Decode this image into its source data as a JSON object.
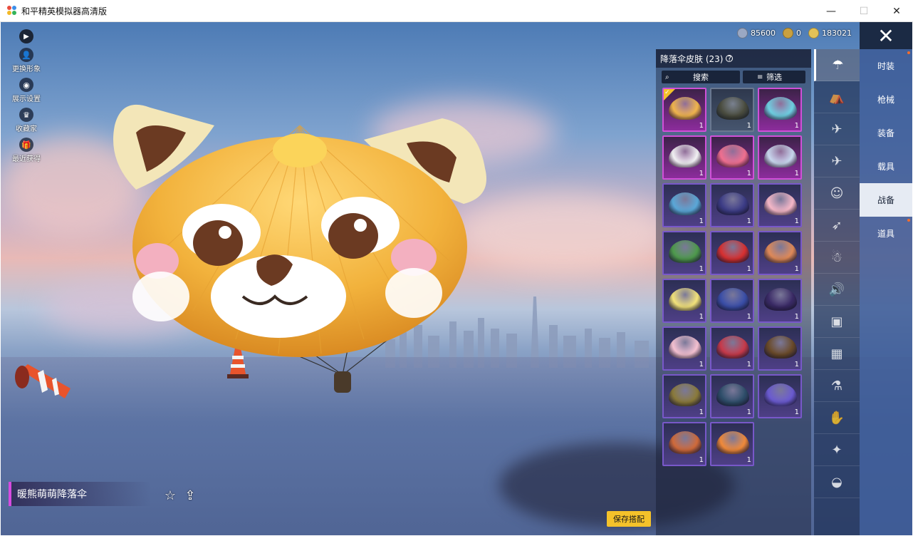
{
  "window": {
    "title": "和平精英模拟器高清版",
    "minimize": "—",
    "maximize": "☐",
    "close": "✕"
  },
  "currency": [
    {
      "icon": "silver-coin-icon",
      "value": "85600",
      "color": "#9aa8c4"
    },
    {
      "icon": "point-coin-icon",
      "value": "0",
      "color": "#c9a040"
    },
    {
      "icon": "gold-coin-icon",
      "value": "183021",
      "color": "#e3c258"
    }
  ],
  "left_icons": [
    {
      "label": "更换形象",
      "glyph": "👤"
    },
    {
      "label": "展示设置",
      "glyph": "◉"
    },
    {
      "label": "收藏家",
      "glyph": "♛"
    },
    {
      "label": "最近获得",
      "glyph": "🎁"
    }
  ],
  "panel": {
    "title": "降落伞皮肤 (23)",
    "search_label": "搜索",
    "filter_label": "筛选"
  },
  "skins": [
    {
      "style": "pink",
      "color": "#f1b64c",
      "count": "1",
      "equipped": true
    },
    {
      "style": "gray",
      "color": "#4a4c3e",
      "count": "1"
    },
    {
      "style": "pink",
      "color": "#6ed0e2",
      "count": "1"
    },
    {
      "style": "pink",
      "color": "#f2f2f4",
      "count": "1"
    },
    {
      "style": "pink",
      "color": "#f07090",
      "count": "1"
    },
    {
      "style": "pink",
      "color": "#c8d8ee",
      "count": "1"
    },
    {
      "style": "blue",
      "color": "#5aa8d8",
      "count": "1"
    },
    {
      "style": "blue",
      "color": "#3c3c86",
      "count": "1"
    },
    {
      "style": "blue",
      "color": "#f6b8c8",
      "count": "1"
    },
    {
      "style": "blue",
      "color": "#4e9a4c",
      "count": "1"
    },
    {
      "style": "blue",
      "color": "#d83030",
      "count": "1"
    },
    {
      "style": "blue",
      "color": "#e08a58",
      "count": "1"
    },
    {
      "style": "blue",
      "color": "#f4e47a",
      "count": "1"
    },
    {
      "style": "blue",
      "color": "#3a4ea8",
      "count": "1"
    },
    {
      "style": "blue",
      "color": "#3a2a66",
      "count": "1"
    },
    {
      "style": "blue",
      "color": "#f6c2d2",
      "count": "1"
    },
    {
      "style": "blue",
      "color": "#c83a4a",
      "count": "1"
    },
    {
      "style": "blue",
      "color": "#6a4a28",
      "count": "1"
    },
    {
      "style": "blue",
      "color": "#8a7a3a",
      "count": "1"
    },
    {
      "style": "blue",
      "color": "#2e4e6a",
      "count": "1"
    },
    {
      "style": "blue",
      "color": "#6a5ad0",
      "count": "1"
    },
    {
      "style": "blue",
      "color": "#d06a3a",
      "count": "1"
    },
    {
      "style": "blue",
      "color": "#f08a3a",
      "count": "1"
    }
  ],
  "icon_tabs": [
    {
      "icon": "parachute-icon",
      "glyph": "☂",
      "active": true
    },
    {
      "icon": "backpack-icon",
      "glyph": "⛺"
    },
    {
      "icon": "plane-trail-icon",
      "glyph": "✈"
    },
    {
      "icon": "plane-icon",
      "glyph": "✈"
    },
    {
      "icon": "emote-face-icon",
      "glyph": "☺"
    },
    {
      "icon": "glider-icon",
      "glyph": "➶"
    },
    {
      "icon": "companion-icon",
      "glyph": "☃"
    },
    {
      "icon": "sound-icon",
      "glyph": "🔊"
    },
    {
      "icon": "card-icon",
      "glyph": "▣"
    },
    {
      "icon": "photo-icon",
      "glyph": "▦"
    },
    {
      "icon": "extinguisher-icon",
      "glyph": "⚗"
    },
    {
      "icon": "hand-icon",
      "glyph": "✋"
    },
    {
      "icon": "magic-wand-icon",
      "glyph": "✦"
    },
    {
      "icon": "pot-icon",
      "glyph": "◒"
    }
  ],
  "categories": [
    {
      "label": "时装",
      "dot": true
    },
    {
      "label": "枪械",
      "dot": false
    },
    {
      "label": "装备",
      "dot": false
    },
    {
      "label": "载具",
      "dot": false
    },
    {
      "label": "战备",
      "dot": false,
      "active": true
    },
    {
      "label": "道具",
      "dot": true
    }
  ],
  "item_name": "暖熊萌萌降落伞",
  "save_label": "保存搭配",
  "colors": {
    "accent_yellow": "#f4c22a",
    "rare_purple": "#d050d8",
    "epic_violet": "#7858c9"
  }
}
